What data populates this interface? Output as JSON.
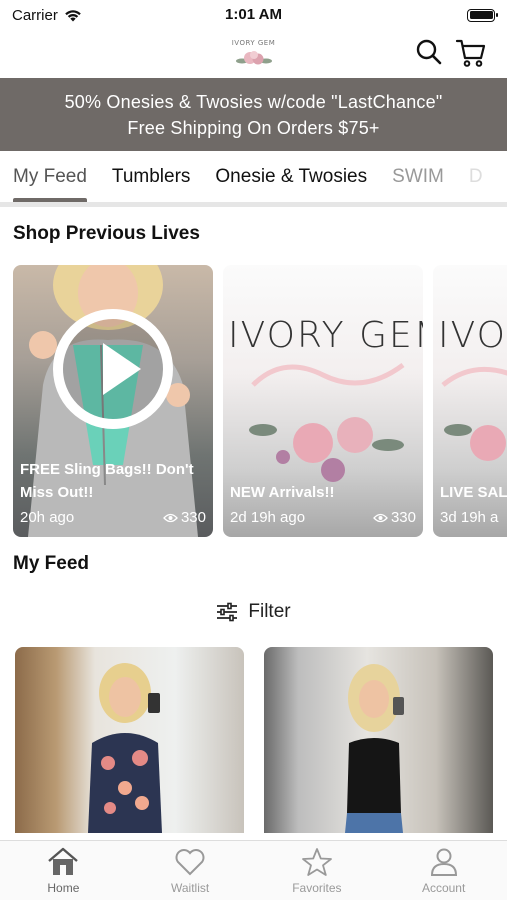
{
  "status": {
    "carrier": "Carrier",
    "time": "1:01 AM"
  },
  "header": {
    "logo_text": "IVORY GEM"
  },
  "promo": {
    "line1": "50% Onesies & Twosies w/code \"LastChance\"",
    "line2": "Free Shipping On Orders $75+"
  },
  "tabs": [
    "My Feed",
    "Tumblers",
    "Onesie & Twosies",
    "SWIM",
    "D"
  ],
  "lives": {
    "title": "Shop Previous Lives",
    "cards": [
      {
        "title": "FREE Sling Bags!! Don't Miss Out!!",
        "time": "20h ago",
        "views": "330"
      },
      {
        "title": "NEW Arrivals!!",
        "time": "2d 19h ago",
        "views": "330",
        "brand": "IVORY GEM"
      },
      {
        "title": "LIVE SALE NEW Arr",
        "time": "3d 19h a",
        "views": "",
        "brand": "IVORY"
      }
    ]
  },
  "feed": {
    "title": "My Feed",
    "filter_label": "Filter"
  },
  "bottom_nav": [
    {
      "label": "Home",
      "icon": "home-icon"
    },
    {
      "label": "Waitlist",
      "icon": "heart-icon"
    },
    {
      "label": "Favorites",
      "icon": "star-icon"
    },
    {
      "label": "Account",
      "icon": "person-icon"
    }
  ],
  "colors": {
    "promo_bg": "#6f6a67",
    "tab_indicator": "#6f6a67"
  }
}
